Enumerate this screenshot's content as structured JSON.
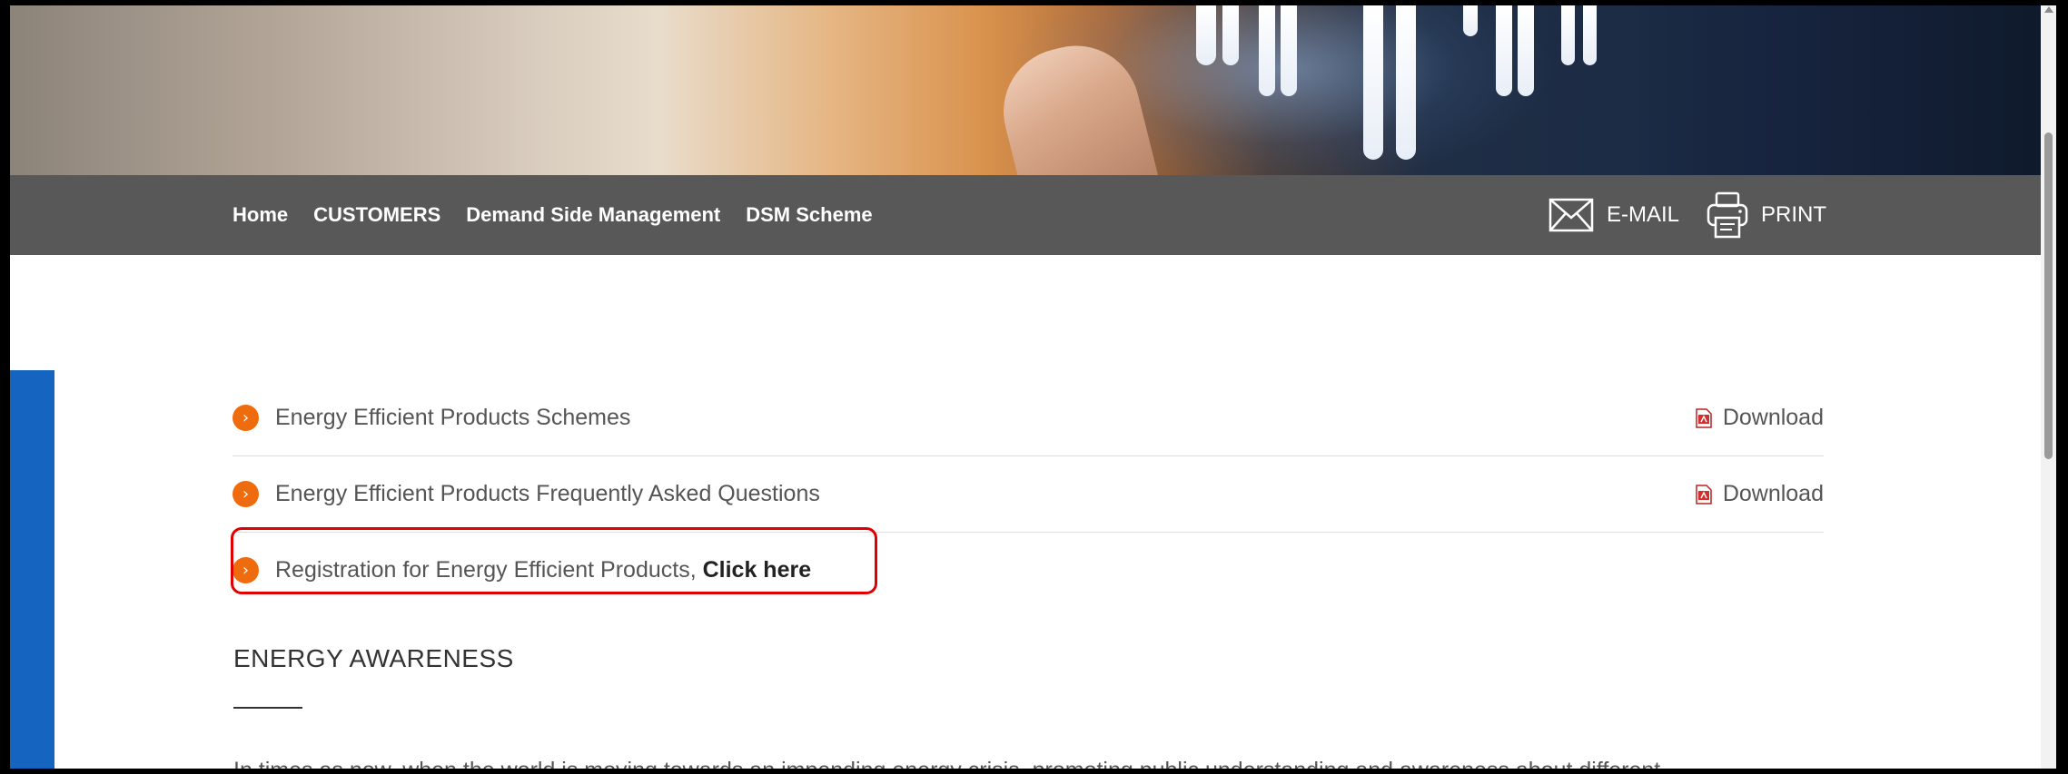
{
  "nav": {
    "breadcrumb": [
      {
        "label": "Home"
      },
      {
        "label": "CUSTOMERS"
      },
      {
        "label": "Demand Side Management"
      },
      {
        "label": "DSM Scheme"
      }
    ],
    "email_label": "E-MAIL",
    "print_label": "PRINT"
  },
  "list": {
    "items": [
      {
        "text": "Energy Efficient Products Schemes",
        "download_label": "Download"
      },
      {
        "text": "Energy Efficient Products Frequently Asked Questions",
        "download_label": "Download"
      },
      {
        "text": "Registration for Energy Efficient Products, ",
        "link_label": "Click here"
      }
    ]
  },
  "section": {
    "title": "ENERGY AWARENESS",
    "paragraph_partial": "In times as now, when the world is moving towards an impending energy crisis, promoting public understanding and awareness about different"
  },
  "colors": {
    "nav_bg": "#585858",
    "accent_orange": "#ef6c0e",
    "highlight_red": "#e00000",
    "strip_blue": "#1565c0"
  }
}
